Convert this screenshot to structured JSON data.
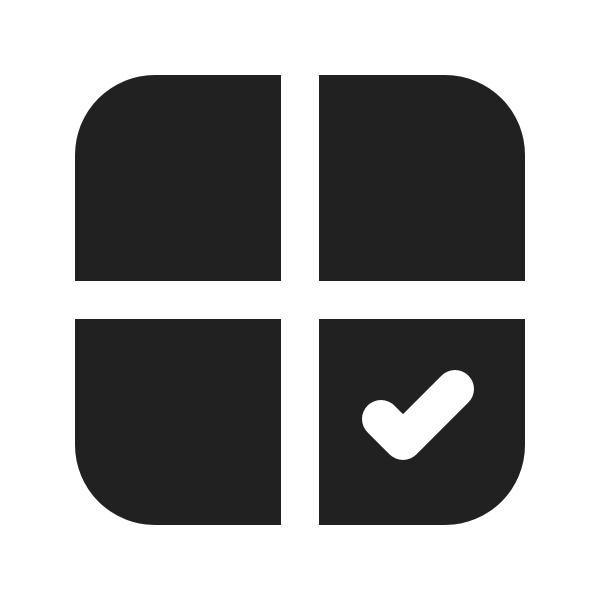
{
  "icon": {
    "name": "calendar-checkmark-grid-icon",
    "fill_color": "#212121",
    "background_color": "#ffffff",
    "check_color": "#ffffff"
  }
}
